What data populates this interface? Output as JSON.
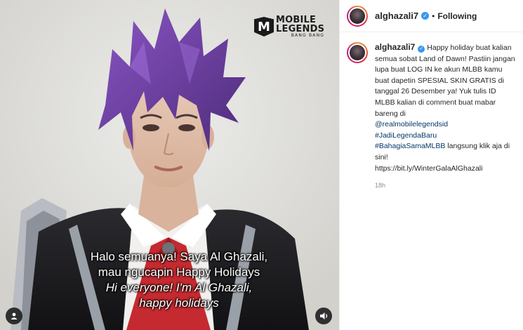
{
  "media": {
    "brand": {
      "line1": "MOBILE",
      "line2": "LEGENDS",
      "line3": "BANG BANG",
      "mark": "M"
    },
    "subtitles": [
      "Halo semuanya! Saya Al Ghazali,",
      "mau ngucapin Happy Holidays",
      "Hi everyone! I'm  Al Ghazali,",
      "happy holidays"
    ],
    "tag_icon": "user-tag-icon",
    "sound_icon": "sound-icon"
  },
  "header": {
    "username": "alghazali7",
    "verified_glyph": "✓",
    "separator": "•",
    "follow_status": "Following"
  },
  "caption": {
    "username": "alghazali7",
    "text": "Happy holiday buat kalian semua sobat Land of Dawn! Pastiin jangan lupa buat LOG IN ke akun MLBB kamu buat dapetin SPESIAL SKIN GRATIS di tanggal 26 Desember ya! Yuk tulis ID MLBB kalian di comment buat mabar bareng di",
    "mention": "@realmobilelegendsid",
    "hashtag1": "#JadiLegendaBaru",
    "hashtag2": "#BahagiaSamaMLBB",
    "text2": "langsung klik aja di sini!",
    "url": "https://bit.ly/WinterGalaAlGhazali",
    "time": "18h"
  },
  "colors": {
    "verified": "#3897f0",
    "link": "#00376b",
    "muted": "#8e8e8e",
    "hair": "#6b3fa0"
  }
}
